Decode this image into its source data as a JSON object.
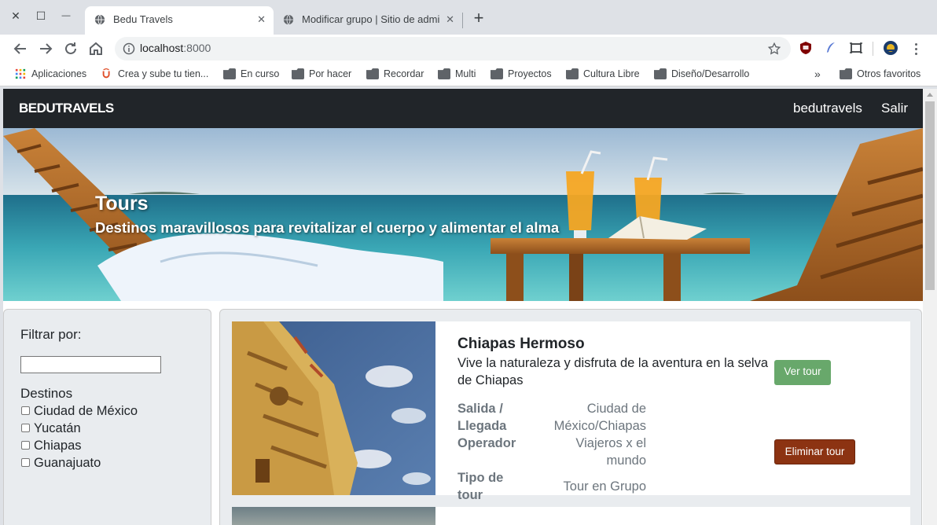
{
  "window": {
    "close_glyph": "✕",
    "maximize_glyph": "☐",
    "minimize_glyph": "—"
  },
  "tabs": [
    {
      "title": "Bedu Travels",
      "active": true,
      "icon": "globe-icon"
    },
    {
      "title": "Modificar grupo | Sitio de administración",
      "active": false,
      "icon": "globe-icon"
    }
  ],
  "newtab_glyph": "+",
  "tab_close_glyph": "✕",
  "address_bar": {
    "host": "localhost",
    "port": ":8000"
  },
  "bookmarks": [
    {
      "label": "Aplicaciones",
      "icon": "apps-grid-icon"
    },
    {
      "label": "Crea y sube tu tien...",
      "icon": "udemy-icon"
    },
    {
      "label": "En curso",
      "icon": "folder-icon"
    },
    {
      "label": "Por hacer",
      "icon": "folder-icon"
    },
    {
      "label": "Recordar",
      "icon": "folder-icon"
    },
    {
      "label": "Multi",
      "icon": "folder-icon"
    },
    {
      "label": "Proyectos",
      "icon": "folder-icon"
    },
    {
      "label": "Cultura Libre",
      "icon": "folder-icon"
    },
    {
      "label": "Diseño/Desarrollo",
      "icon": "folder-icon"
    }
  ],
  "bookmarks_overflow": "»",
  "other_bookmarks": "Otros favoritos",
  "site": {
    "brand": "BEDUTRAVELS",
    "nav": [
      "bedutravels",
      "Salir"
    ]
  },
  "hero": {
    "title": "Tours",
    "subtitle": "Destinos maravillosos para revitalizar el cuerpo y alimentar el alma"
  },
  "sidebar": {
    "filter_label": "Filtrar por:",
    "filter_value": "",
    "destinations_label": "Destinos",
    "destinations": [
      "Ciudad de México",
      "Yucatán",
      "Chiapas",
      "Guanajuato"
    ]
  },
  "tour": {
    "title": "Chiapas Hermoso",
    "description": "Vive la naturaleza y disfruta de la aventura en la selva de Chiapas",
    "details": [
      {
        "key": "Salida / Llegada",
        "value": "Ciudad de México/Chiapas"
      },
      {
        "key": "Operador",
        "value": "Viajeros x el mundo"
      },
      {
        "key": "Tipo de tour",
        "value": "Tour en Grupo"
      }
    ],
    "view_button": "Ver tour",
    "delete_button": "Eliminar tour"
  },
  "colors": {
    "navbar": "#212529",
    "view_button": "#68a86b",
    "delete_button": "#8c3312",
    "panel": "#e9ecef"
  }
}
